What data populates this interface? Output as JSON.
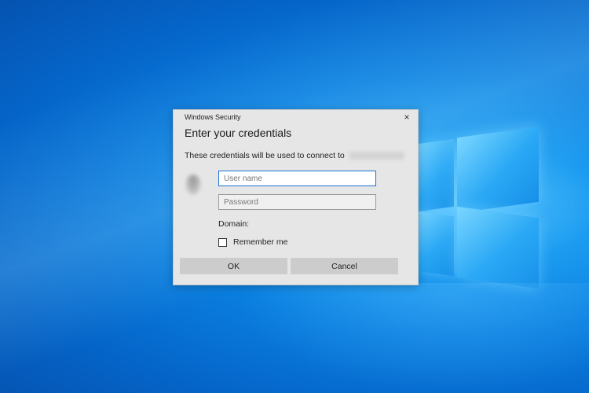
{
  "desktop": {
    "wallpaper": "windows-10-light-blue",
    "accent_color": "#0a7fe0"
  },
  "dialog": {
    "window_title": "Windows Security",
    "close_icon": "×",
    "heading": "Enter your credentials",
    "message": "These credentials will be used to connect to",
    "username": {
      "value": "",
      "placeholder": "User name"
    },
    "password": {
      "value": "",
      "placeholder": "Password"
    },
    "domain_label": "Domain:",
    "remember_label": "Remember me",
    "remember_checked": false,
    "ok_label": "OK",
    "cancel_label": "Cancel"
  }
}
